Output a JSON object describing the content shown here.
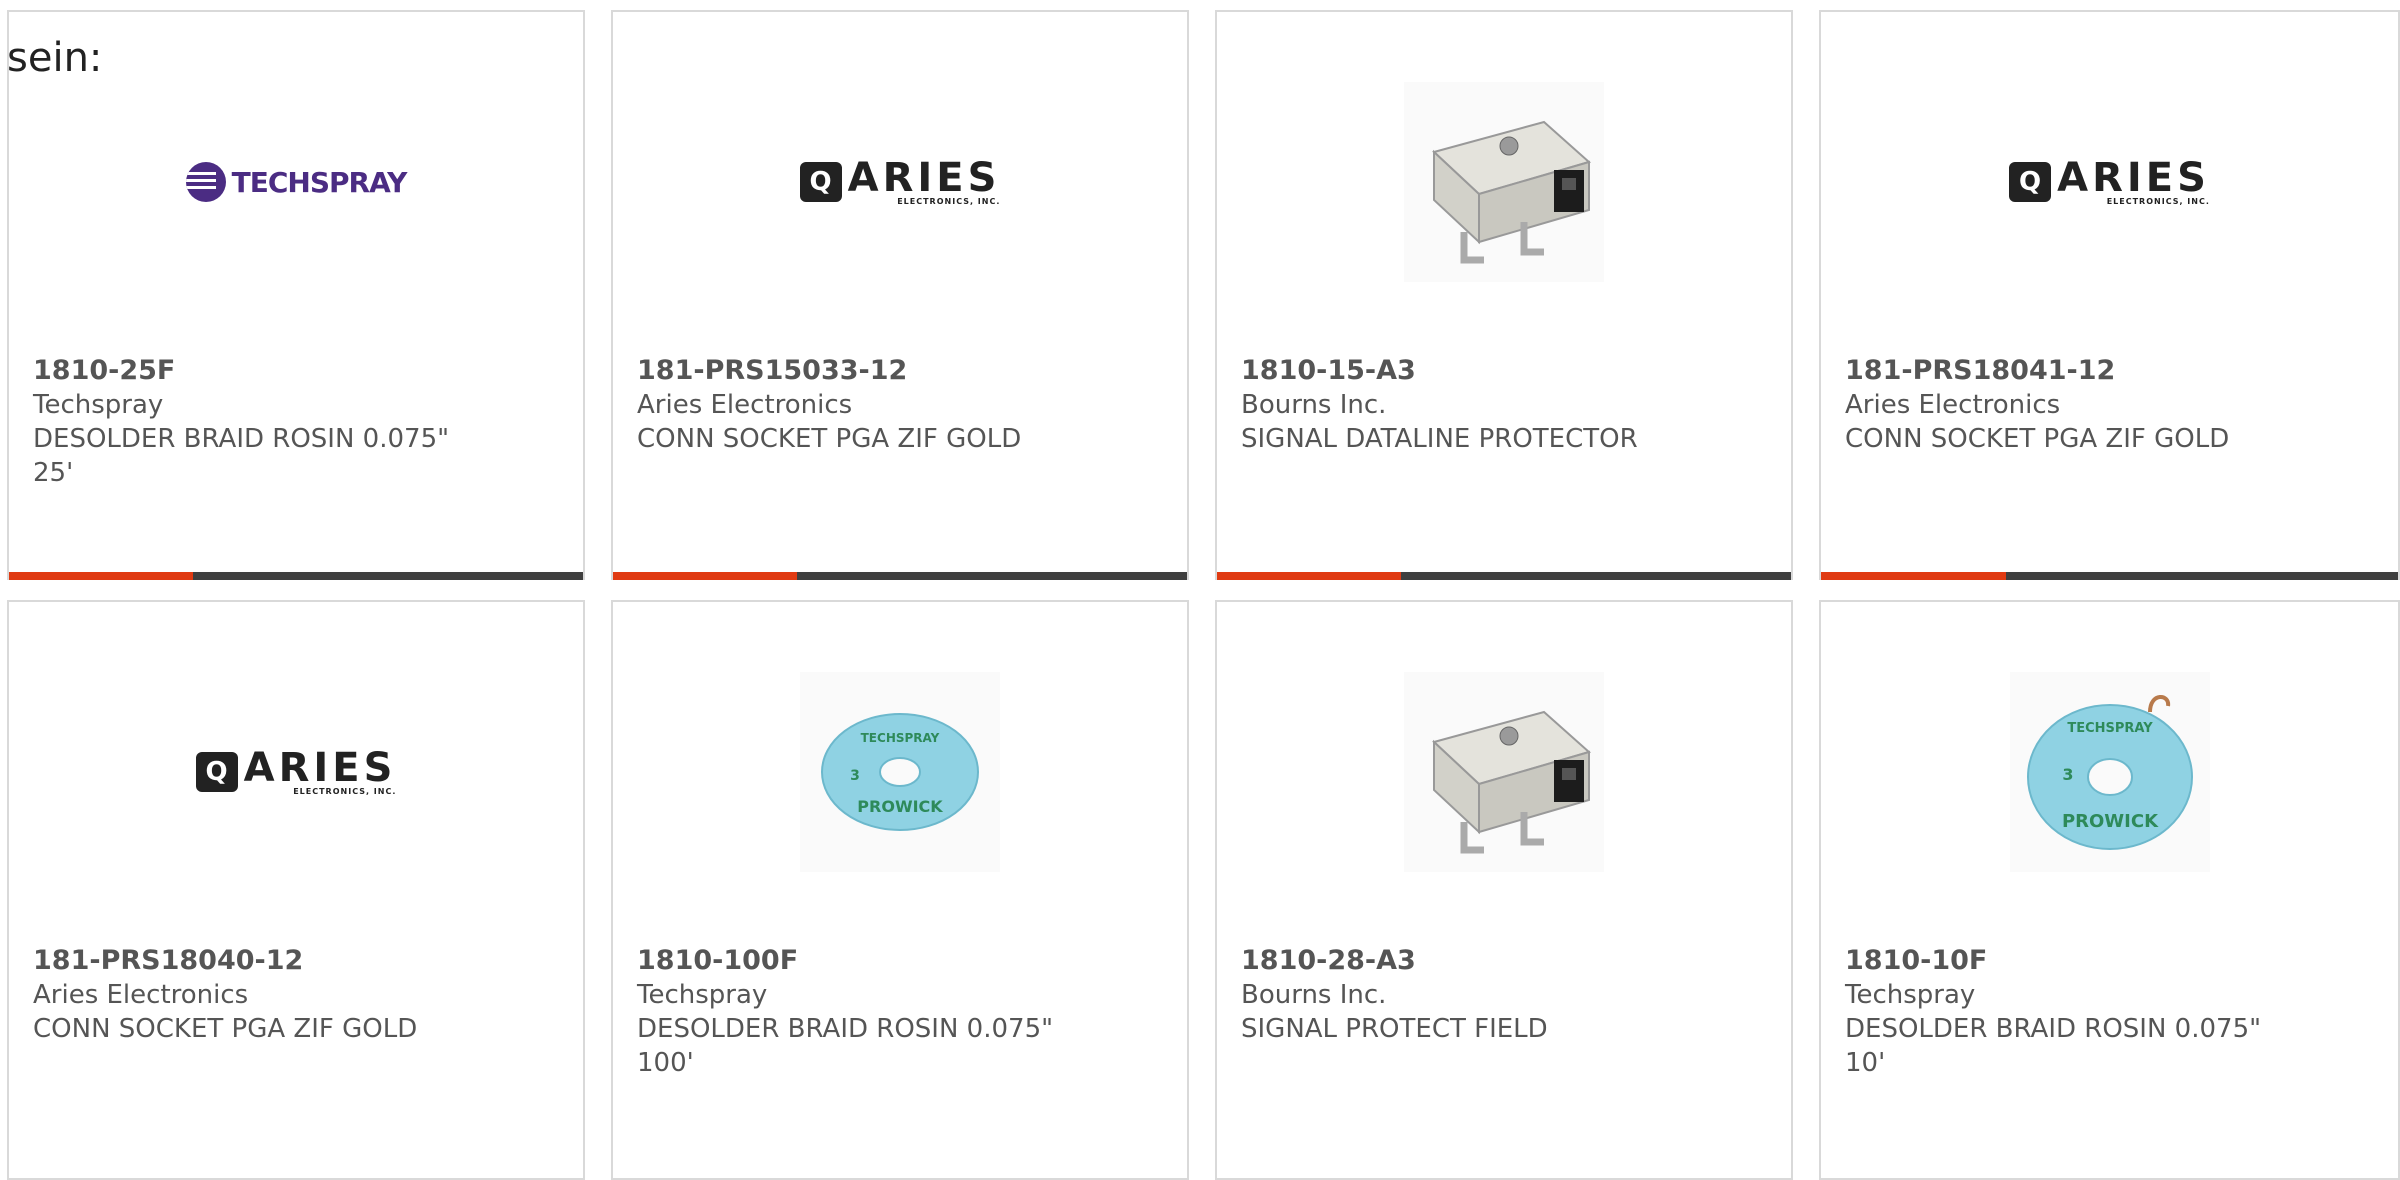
{
  "header": {
    "label": "sein:"
  },
  "colors": {
    "accent": "#e03a12",
    "bar": "#3f3f3f",
    "border": "#d9d9d9"
  },
  "products": [
    {
      "part_number": "1810-25F",
      "manufacturer": "Techspray",
      "description": "DESOLDER BRAID ROSIN 0.075\" 25'",
      "image": "techspray-logo"
    },
    {
      "part_number": "181-PRS15033-12",
      "manufacturer": "Aries Electronics",
      "description": "CONN SOCKET PGA ZIF GOLD",
      "image": "aries-logo"
    },
    {
      "part_number": "1810-15-A3",
      "manufacturer": "Bourns Inc.",
      "description": "SIGNAL DATALINE PROTECTOR",
      "image": "dataline-protector-photo"
    },
    {
      "part_number": "181-PRS18041-12",
      "manufacturer": "Aries Electronics",
      "description": "CONN SOCKET PGA ZIF GOLD",
      "image": "aries-logo"
    },
    {
      "part_number": "181-PRS18040-12",
      "manufacturer": "Aries Electronics",
      "description": "CONN SOCKET PGA ZIF GOLD",
      "image": "aries-logo"
    },
    {
      "part_number": "1810-100F",
      "manufacturer": "Techspray",
      "description": "DESOLDER BRAID ROSIN 0.075\" 100'",
      "image": "prowick-spool-photo"
    },
    {
      "part_number": "1810-28-A3",
      "manufacturer": "Bourns Inc.",
      "description": "SIGNAL PROTECT FIELD",
      "image": "dataline-protector-photo"
    },
    {
      "part_number": "1810-10F",
      "manufacturer": "Techspray",
      "description": "DESOLDER BRAID ROSIN 0.075\" 10'",
      "image": "prowick-spool-photo"
    }
  ],
  "logos": {
    "techspray": "TECHSPRAY",
    "aries": "ARIES",
    "aries_sub": "ELECTRONICS, INC.",
    "aries_mark": "Q",
    "prowick_brand": "TECHSPRAY",
    "prowick": "PROWICK",
    "prowick_size": "3"
  }
}
